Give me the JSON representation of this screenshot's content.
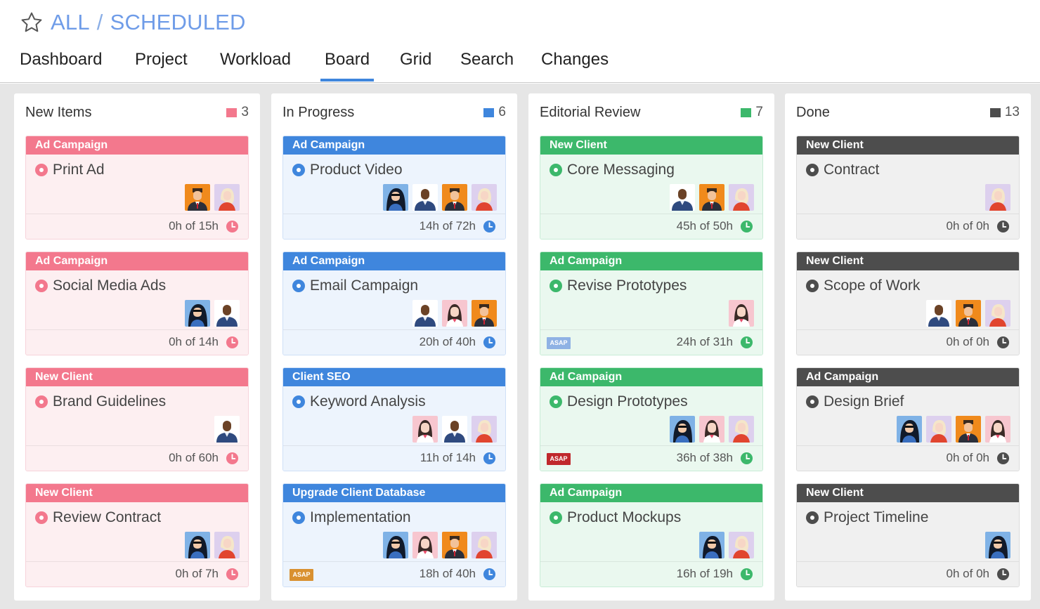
{
  "header": {
    "breadcrumb": [
      "ALL",
      "/",
      "SCHEDULED"
    ],
    "tabs": [
      "Dashboard",
      "Project",
      "Workload",
      "Board",
      "Grid",
      "Search",
      "Changes"
    ],
    "active_tab": "Board"
  },
  "colors": {
    "accent": "#3f86dd",
    "pink": "#f3788d",
    "blue": "#3f86dd",
    "green": "#3cb86b",
    "gray": "#4d4d4d"
  },
  "columns": [
    {
      "title": "New Items",
      "count": "3",
      "theme": "pink",
      "cards": [
        {
          "tag": "Ad Campaign",
          "title": "Print Ad",
          "avatars": [
            "man-orange-avatar",
            "woman-red-avatar"
          ],
          "hours": "0h of 15h",
          "asap": ""
        },
        {
          "tag": "Ad Campaign",
          "title": "Social Media Ads",
          "avatars": [
            "woman-sunglasses-avatar",
            "man-dark-avatar"
          ],
          "hours": "0h of 14h",
          "asap": ""
        },
        {
          "tag": "New Client",
          "title": "Brand Guidelines",
          "avatars": [
            "man-dark-avatar"
          ],
          "hours": "0h of 60h",
          "asap": ""
        },
        {
          "tag": "New Client",
          "title": "Review Contract",
          "avatars": [
            "woman-sunglasses-avatar",
            "woman-red-avatar"
          ],
          "hours": "0h of 7h",
          "asap": ""
        }
      ]
    },
    {
      "title": "In Progress",
      "count": "6",
      "theme": "blue",
      "cards": [
        {
          "tag": "Ad Campaign",
          "title": "Product Video",
          "avatars": [
            "woman-sunglasses-avatar",
            "man-dark-avatar",
            "man-orange-avatar",
            "woman-red-avatar"
          ],
          "hours": "14h of 72h",
          "asap": ""
        },
        {
          "tag": "Ad Campaign",
          "title": "Email Campaign",
          "avatars": [
            "man-dark-avatar",
            "woman-pink-avatar",
            "man-orange-avatar"
          ],
          "hours": "20h of 40h",
          "asap": ""
        },
        {
          "tag": "Client SEO",
          "title": "Keyword Analysis",
          "avatars": [
            "woman-pink-avatar",
            "man-dark-avatar",
            "woman-red-avatar"
          ],
          "hours": "11h of 14h",
          "asap": ""
        },
        {
          "tag": "Upgrade Client Database",
          "title": "Implementation",
          "avatars": [
            "woman-sunglasses-avatar",
            "woman-pink-avatar",
            "man-orange-avatar",
            "woman-red-avatar"
          ],
          "hours": "18h of 40h",
          "asap": "ASAP"
        }
      ]
    },
    {
      "title": "Editorial Review",
      "count": "7",
      "theme": "green",
      "cards": [
        {
          "tag": "New Client",
          "title": "Core Messaging",
          "avatars": [
            "man-dark-avatar",
            "man-orange-avatar",
            "woman-red-avatar"
          ],
          "hours": "45h of 50h",
          "asap": ""
        },
        {
          "tag": "Ad Campaign",
          "title": "Revise Prototypes",
          "avatars": [
            "woman-pink-avatar"
          ],
          "hours": "24h of 31h",
          "asap": "ASAP"
        },
        {
          "tag": "Ad Campaign",
          "title": "Design Prototypes",
          "avatars": [
            "woman-sunglasses-avatar",
            "woman-pink-avatar",
            "woman-red-avatar"
          ],
          "hours": "36h of 38h",
          "asap": "ASAP"
        },
        {
          "tag": "Ad Campaign",
          "title": "Product Mockups",
          "avatars": [
            "woman-sunglasses-avatar",
            "woman-red-avatar"
          ],
          "hours": "16h of 19h",
          "asap": ""
        }
      ]
    },
    {
      "title": "Done",
      "count": "13",
      "theme": "gray",
      "cards": [
        {
          "tag": "New Client",
          "title": "Contract",
          "avatars": [
            "woman-red-avatar"
          ],
          "hours": "0h of 0h",
          "asap": ""
        },
        {
          "tag": "New Client",
          "title": "Scope of Work",
          "avatars": [
            "man-dark-avatar",
            "man-orange-avatar",
            "woman-red-avatar"
          ],
          "hours": "0h of 0h",
          "asap": ""
        },
        {
          "tag": "Ad Campaign",
          "title": "Design Brief",
          "avatars": [
            "woman-sunglasses-avatar",
            "woman-red-avatar",
            "man-orange-avatar",
            "woman-pink-avatar"
          ],
          "hours": "0h of 0h",
          "asap": ""
        },
        {
          "tag": "New Client",
          "title": "Project Timeline",
          "avatars": [
            "woman-sunglasses-avatar"
          ],
          "hours": "0h of 0h",
          "asap": ""
        }
      ]
    }
  ]
}
